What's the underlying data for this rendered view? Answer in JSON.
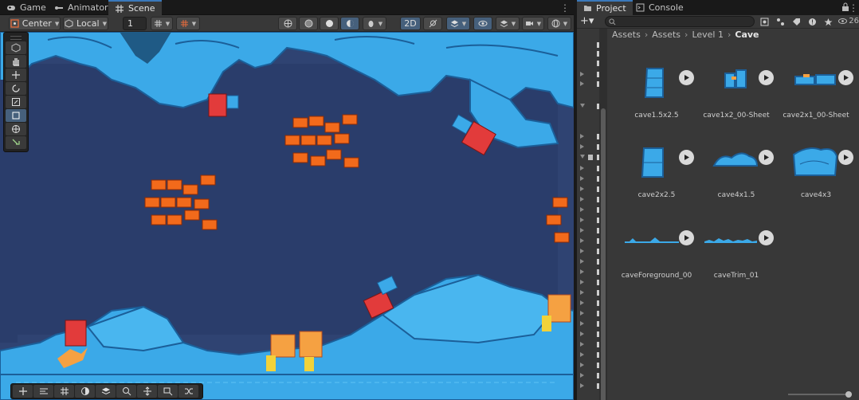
{
  "left_tabs": [
    {
      "label": "Game",
      "icon": "gamepad-icon"
    },
    {
      "label": "Animator",
      "icon": "animator-icon"
    },
    {
      "label": "Scene",
      "icon": "scene-grid-icon",
      "active": true
    }
  ],
  "scene_toolbar": {
    "pivot_mode": "Center",
    "pivot_rotation": "Local",
    "grid_increment": "1",
    "mode_2d": "2D"
  },
  "right_tabs": [
    {
      "label": "Project",
      "icon": "folder-icon",
      "active": true
    },
    {
      "label": "Console",
      "icon": "console-icon"
    }
  ],
  "project": {
    "hidden_count": "26",
    "breadcrumb": [
      "Assets",
      "Assets",
      "Level 1",
      "Cave"
    ],
    "assets": [
      {
        "name": "cave1.5x2.5",
        "icon": "sprite-thumbnail"
      },
      {
        "name": "cave1x2_00-Sheet",
        "icon": "sprite-thumbnail"
      },
      {
        "name": "cave2x1_00-Sheet",
        "icon": "sprite-thumbnail"
      },
      {
        "name": "cave2x2.5",
        "icon": "sprite-thumbnail"
      },
      {
        "name": "cave4x1.5",
        "icon": "sprite-thumbnail"
      },
      {
        "name": "cave4x3",
        "icon": "sprite-thumbnail"
      },
      {
        "name": "caveForeground_00",
        "icon": "sprite-thumbnail"
      },
      {
        "name": "caveTrim_01",
        "icon": "sprite-thumbnail"
      }
    ]
  },
  "colors": {
    "accent": "#3a79bb",
    "scene_bg": "#2f4372",
    "rock": "#3ba9e8",
    "rock_dark": "#1b5f99",
    "coral": "#e23b3b",
    "fish": "#f26a1b"
  }
}
